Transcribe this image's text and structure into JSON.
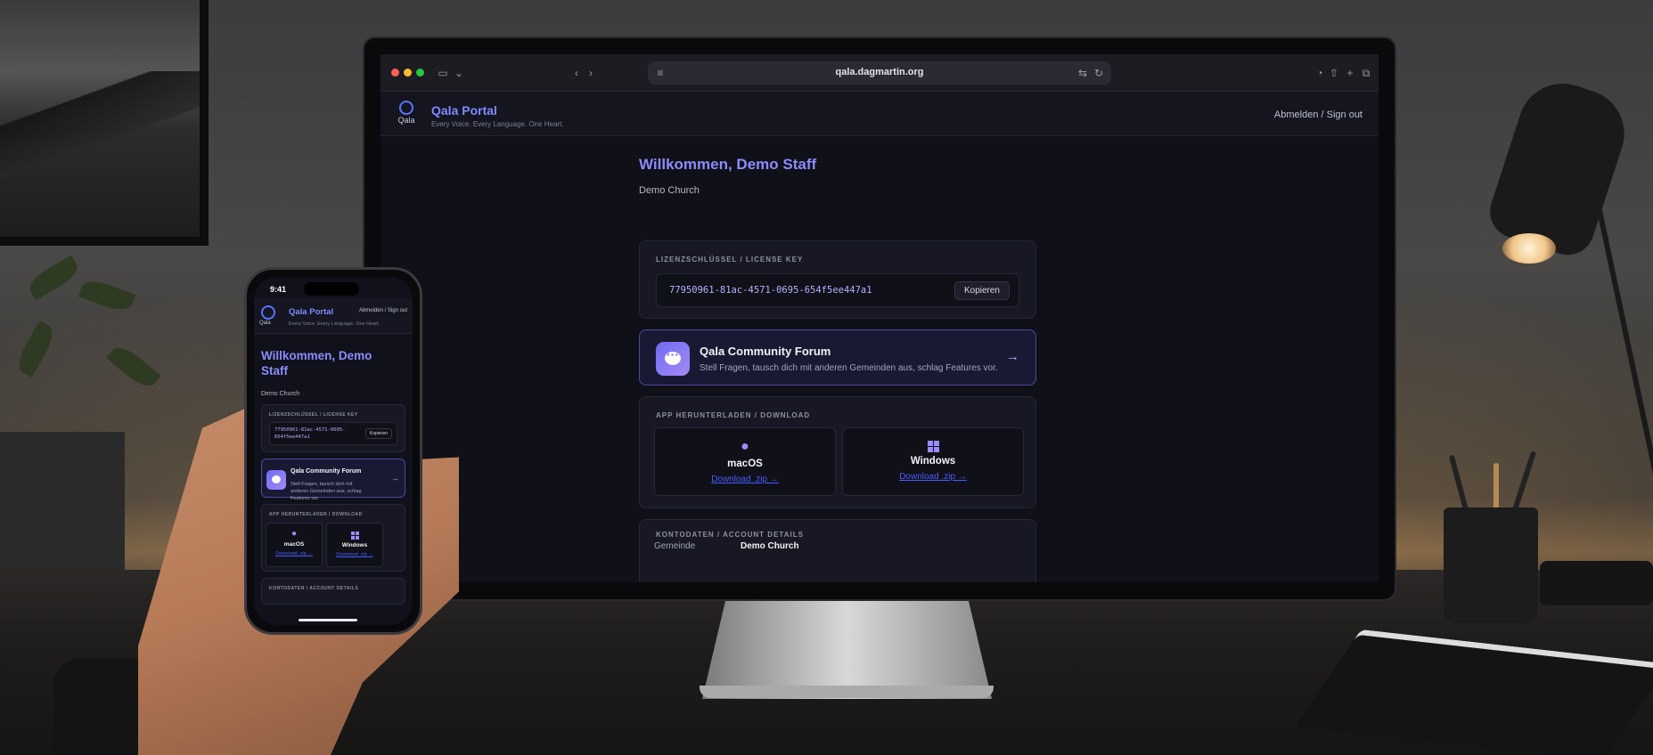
{
  "browser": {
    "url": "qala.dagmartin.org"
  },
  "site": {
    "logo_text": "Qala",
    "title": "Qala Portal",
    "tagline": "Every Voice. Every Language. One Heart.",
    "signout": "Abmelden / Sign out"
  },
  "welcome": {
    "heading": "Willkommen, Demo Staff",
    "church": "Demo Church"
  },
  "license": {
    "label": "LIZENZSCHLÜSSEL / LICENSE KEY",
    "key": "77950961-81ac-4571-0695-654f5ee447a1",
    "copy_label": "Kopieren"
  },
  "forum": {
    "title": "Qala Community Forum",
    "subtitle": "Stell Fragen, tausch dich mit anderen Gemeinden aus, schlag Features vor.",
    "arrow": "→"
  },
  "download": {
    "label": "APP HERUNTERLADEN / DOWNLOAD",
    "items": [
      {
        "name": "macOS",
        "link": "Download .zip →",
        "icon": "apple-icon"
      },
      {
        "name": "Windows",
        "link": "Download .zip →",
        "icon": "windows-icon"
      }
    ]
  },
  "account": {
    "label": "KONTODATEN / ACCOUNT DETAILS",
    "rows": [
      {
        "key": "Gemeinde",
        "value": "Demo Church"
      }
    ]
  },
  "phone": {
    "time": "9:41",
    "welcome_line1": "Willkommen, Demo",
    "welcome_line2": "Staff",
    "key_line1": "77950961-81ac-4571-0695-",
    "key_line2": "654f5ee447a1",
    "forum_subtitle": "Stell Fragen, tausch dich mit anderen Gemeinden aus, schlag Features vor."
  },
  "colors": {
    "accent": "#8c8cff",
    "link": "#4a5bff",
    "background": "#0f1018"
  }
}
